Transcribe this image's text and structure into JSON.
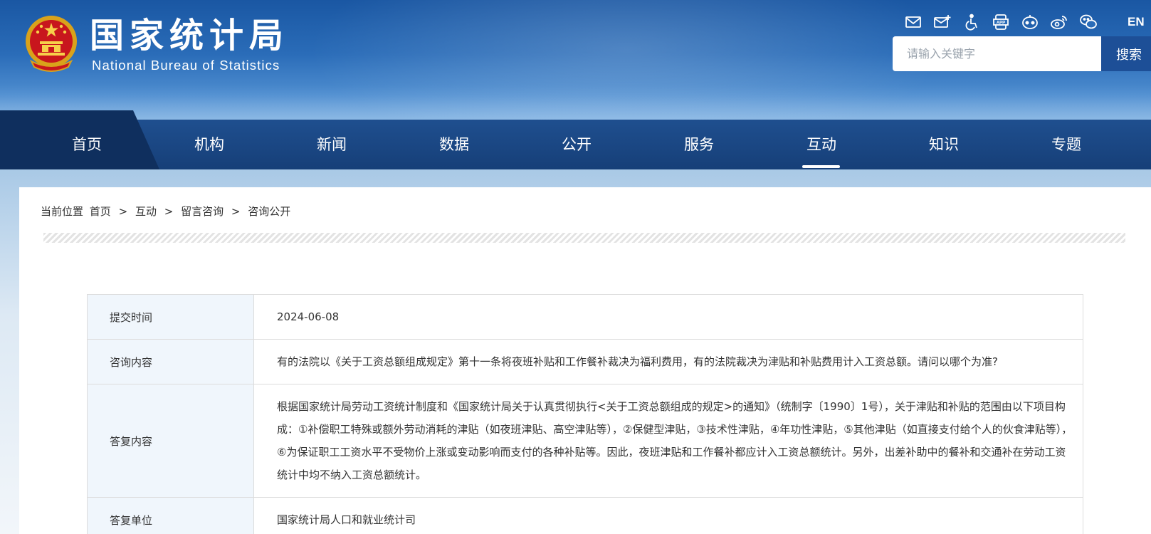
{
  "header": {
    "logo_cn": "国家统计局",
    "logo_en": "National Bureau of Statistics",
    "top_icons": [
      "mail-icon",
      "mailbox-icon",
      "accessibility-icon",
      "app-icon",
      "robot-icon",
      "weibo-icon",
      "wechat-icon"
    ],
    "lang_label": "EN",
    "search_placeholder": "请输入关键字",
    "search_button": "搜索"
  },
  "nav": {
    "items": [
      {
        "label": "首页"
      },
      {
        "label": "机构"
      },
      {
        "label": "新闻"
      },
      {
        "label": "数据"
      },
      {
        "label": "公开"
      },
      {
        "label": "服务"
      },
      {
        "label": "互动"
      },
      {
        "label": "知识"
      },
      {
        "label": "专题"
      }
    ],
    "active": "互动"
  },
  "breadcrumb": {
    "prefix": "当前位置",
    "items": [
      "首页",
      "互动",
      "留言咨询",
      "咨询公开"
    ],
    "separator": ">"
  },
  "record": {
    "submit_time_label": "提交时间",
    "submit_time": "2024-06-08",
    "question_label": "咨询内容",
    "question": "有的法院以《关于工资总额组成规定》第十一条将夜班补贴和工作餐补裁决为福利费用，有的法院裁决为津贴和补贴费用计入工资总额。请问以哪个为准?",
    "answer_label": "答复内容",
    "answer": "根据国家统计局劳动工资统计制度和《国家统计局关于认真贯彻执行<关于工资总额组成的规定>的通知》（统制字〔1990〕1号），关于津贴和补贴的范围由以下项目构成：①补偿职工特殊或额外劳动消耗的津贴（如夜班津贴、高空津贴等），②保健型津贴，③技术性津贴，④年功性津贴，⑤其他津贴（如直接支付给个人的伙食津贴等），⑥为保证职工工资水平不受物价上涨或变动影响而支付的各种补贴等。因此，夜班津贴和工作餐补都应计入工资总额统计。另外，出差补助中的餐补和交通补在劳动工资统计中均不纳入工资总额统计。",
    "unit_label": "答复单位",
    "unit": "国家统计局人口和就业统计司"
  },
  "colors": {
    "header_top": "#1a57a3",
    "nav_bg": "#163f78",
    "nav_home_bg": "#0f2f5e",
    "search_button_bg": "#1d4f97",
    "label_cell_bg": "#f0f6fc"
  }
}
